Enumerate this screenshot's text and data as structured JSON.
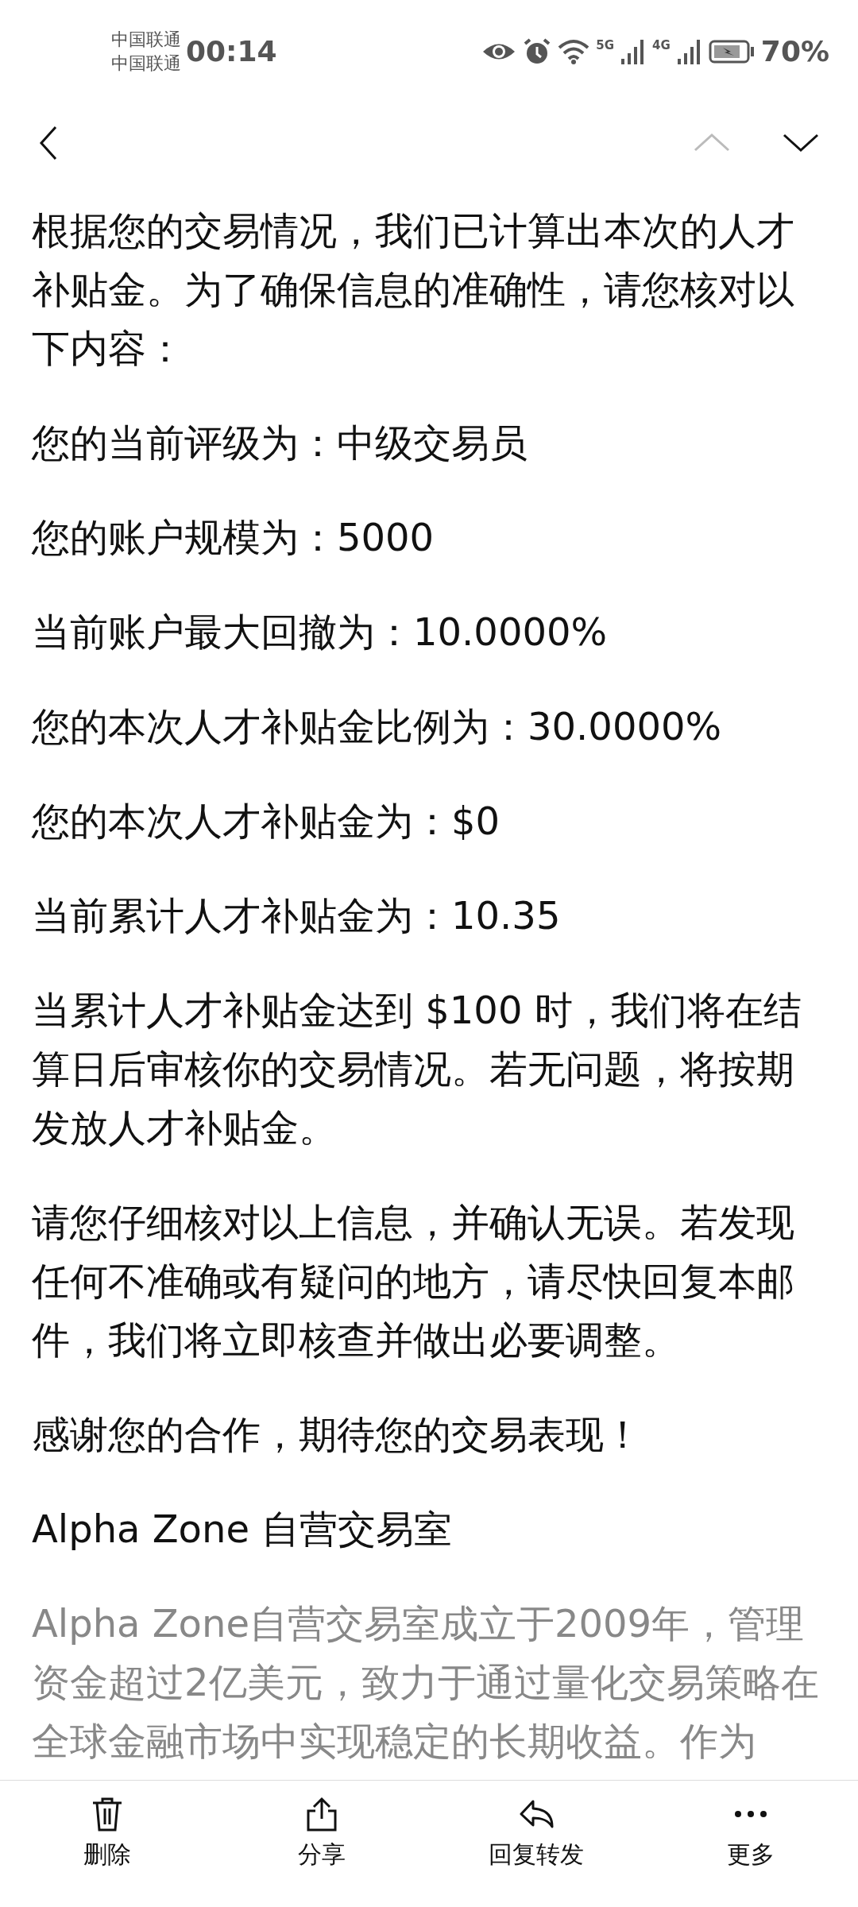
{
  "status_bar": {
    "carriers": [
      "中国联通",
      "中国联通"
    ],
    "time": "00:14",
    "network_labels": [
      "5G",
      "4G"
    ],
    "battery": "70%"
  },
  "toolbar": {
    "previous": {
      "disabled": true
    },
    "next": {
      "disabled": false
    }
  },
  "body": [
    {
      "kind": "text",
      "text": "根据您的交易情况，我们已计算出本次的人才补贴金。为了确保信息的准确性，请您核对以下内容："
    },
    {
      "kind": "text",
      "text": "您的当前评级为：中级交易员"
    },
    {
      "kind": "text",
      "text": "您的账户规模为：5000"
    },
    {
      "kind": "text",
      "text": "当前账户最大回撤为：10.0000%"
    },
    {
      "kind": "text",
      "text": "您的本次人才补贴金比例为：30.0000%"
    },
    {
      "kind": "text",
      "text": "您的本次人才补贴金为：$0"
    },
    {
      "kind": "text",
      "text": "当前累计人才补贴金为：10.35"
    },
    {
      "kind": "text",
      "text": "当累计人才补贴金达到 $100 时，我们将在结算日后审核你的交易情况。若无问题，将按期发放人才补贴金。"
    },
    {
      "kind": "text",
      "text": "请您仔细核对以上信息，并确认无误。若发现任何不准确或有疑问的地方，请尽快回复本邮件，我们将立即核查并做出必要调整。"
    },
    {
      "kind": "text",
      "text": "感谢您的合作，期待您的交易表现！"
    },
    {
      "kind": "text",
      "text": "Alpha Zone 自营交易室"
    },
    {
      "kind": "muted",
      "text": "Alpha Zone自营交易室成立于2009年，管理资金超过2亿美元，致力于通过量化交易策略在全球金融市场中实现稳定的长期收益。作为"
    }
  ],
  "actions": [
    {
      "label": "删除"
    },
    {
      "label": "分享"
    },
    {
      "label": "回复转发"
    },
    {
      "label": "更多"
    }
  ]
}
